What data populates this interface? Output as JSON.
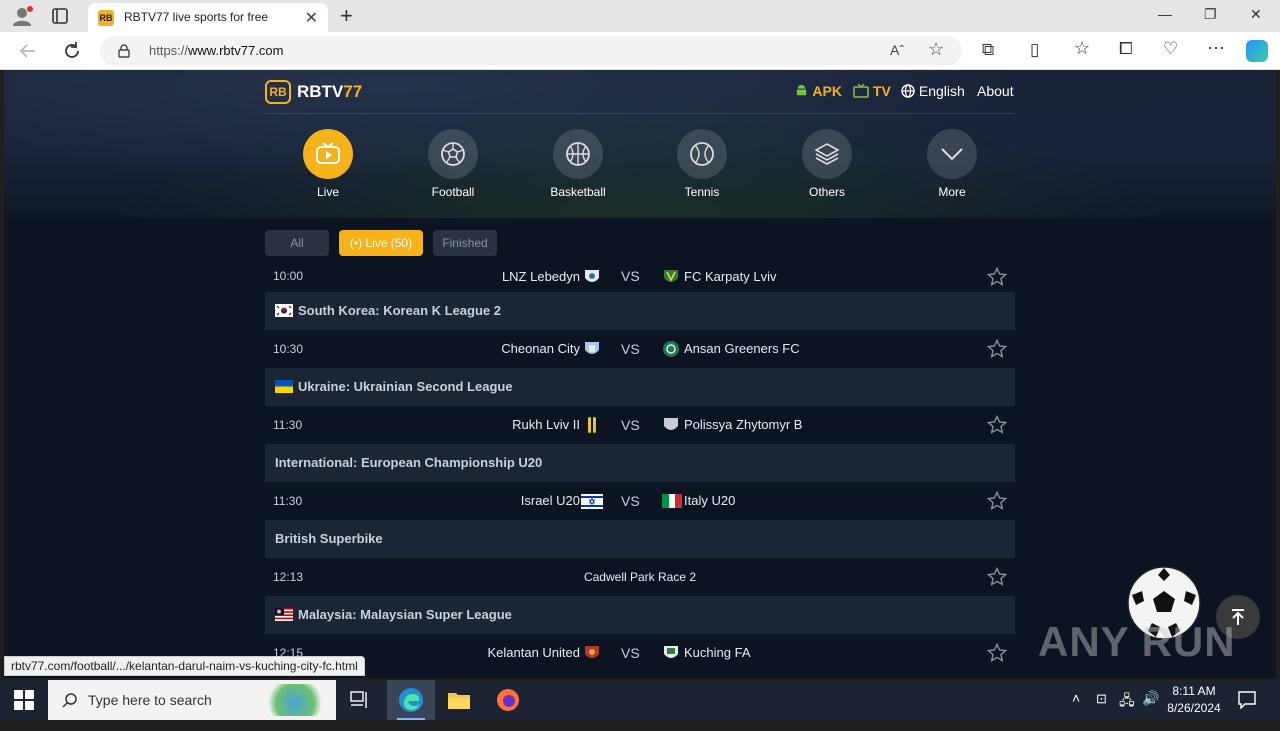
{
  "browser": {
    "tab_title": "RBTV77 live sports for free",
    "tab_favicon_text": "RB",
    "url_scheme": "https://",
    "url_host": "www.rbtv77.com",
    "status_url": "rbtv77.com/football/.../kelantan-darul-naim-vs-kuching-city-fc.html"
  },
  "site": {
    "logo_mark": "RB",
    "brand_main": "RBTV",
    "brand_accent": "77",
    "nav": {
      "apk": "APK",
      "tv": "TV",
      "language": "English",
      "about": "About"
    },
    "categories": [
      {
        "label": "Live",
        "icon": "live-tv-icon",
        "active": true
      },
      {
        "label": "Football",
        "icon": "football-icon",
        "active": false
      },
      {
        "label": "Basketball",
        "icon": "basketball-icon",
        "active": false
      },
      {
        "label": "Tennis",
        "icon": "tennis-icon",
        "active": false
      },
      {
        "label": "Others",
        "icon": "layers-icon",
        "active": false
      },
      {
        "label": "More",
        "icon": "chevron-down-icon",
        "active": false
      }
    ],
    "filters": {
      "all": "All",
      "live": "(•) Live (50)",
      "finished": "Finished"
    },
    "accent_color": "#f5b21b"
  },
  "matches": [
    {
      "time": "10:00",
      "home": "LNZ Lebedyn",
      "vs": "VS",
      "away": "FC Karpaty Lviv"
    },
    {
      "league": "South Korea: Korean K League 2",
      "flag": "south-korea-flag"
    },
    {
      "time": "10:30",
      "home": "Cheonan City",
      "vs": "VS",
      "away": "Ansan Greeners FC"
    },
    {
      "league": "Ukraine: Ukrainian Second League",
      "flag": "ukraine-flag"
    },
    {
      "time": "11:30",
      "home": "Rukh Lviv II",
      "vs": "VS",
      "away": "Polissya Zhytomyr B"
    },
    {
      "league": "International: European Championship U20"
    },
    {
      "time": "11:30",
      "home": "Israel U20",
      "vs": "VS",
      "away": "Italy U20"
    },
    {
      "league": "British Superbike"
    },
    {
      "time": "12:13",
      "event": "Cadwell Park Race 2"
    },
    {
      "league": "Malaysia: Malaysian Super League",
      "flag": "malaysia-flag"
    },
    {
      "time": "12:15",
      "home": "Kelantan United",
      "vs": "VS",
      "away": "Kuching FA"
    }
  ],
  "watermark": "ANY RUN",
  "taskbar": {
    "search_placeholder": "Type here to search",
    "time": "8:11 AM",
    "date": "8/26/2024"
  }
}
